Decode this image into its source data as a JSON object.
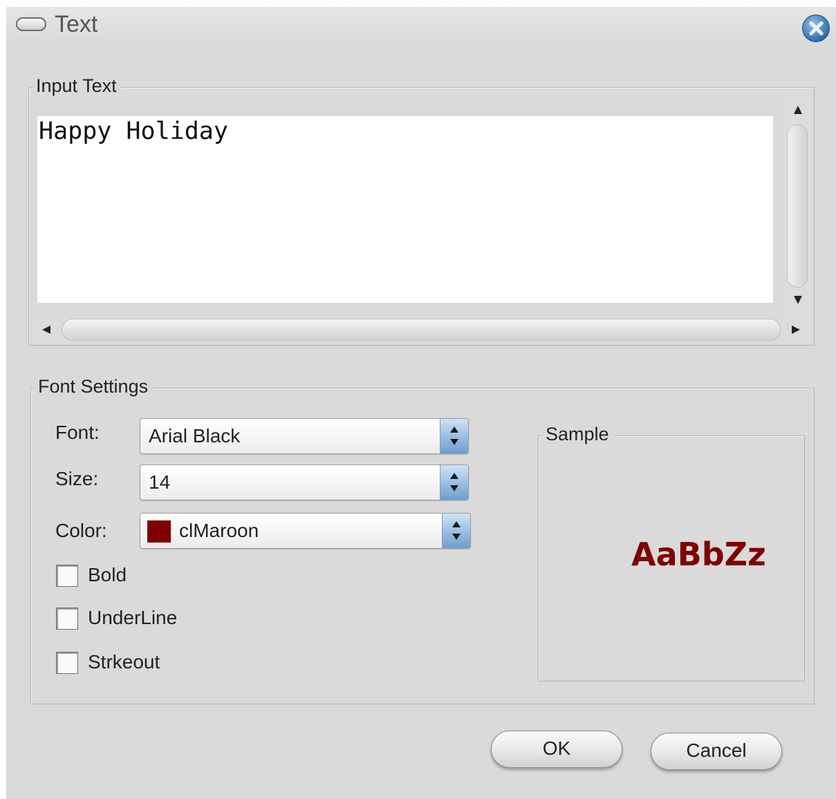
{
  "window": {
    "title": "Text"
  },
  "input_group": {
    "label": "Input Text",
    "text": "Happy Holiday"
  },
  "font_group": {
    "label": "Font Settings",
    "font_label": "Font:",
    "font_value": "Arial Black",
    "size_label": "Size:",
    "size_value": "14",
    "color_label": "Color:",
    "color_value": "clMaroon",
    "color_hex": "#800000",
    "bold_label": "Bold",
    "bold_checked": false,
    "underline_label": "UnderLine",
    "underline_checked": false,
    "strikeout_label": "Strkeout",
    "strikeout_checked": false
  },
  "sample_group": {
    "label": "Sample",
    "text": "AaBbZz"
  },
  "buttons": {
    "ok_label": "OK",
    "cancel_label": "Cancel"
  }
}
